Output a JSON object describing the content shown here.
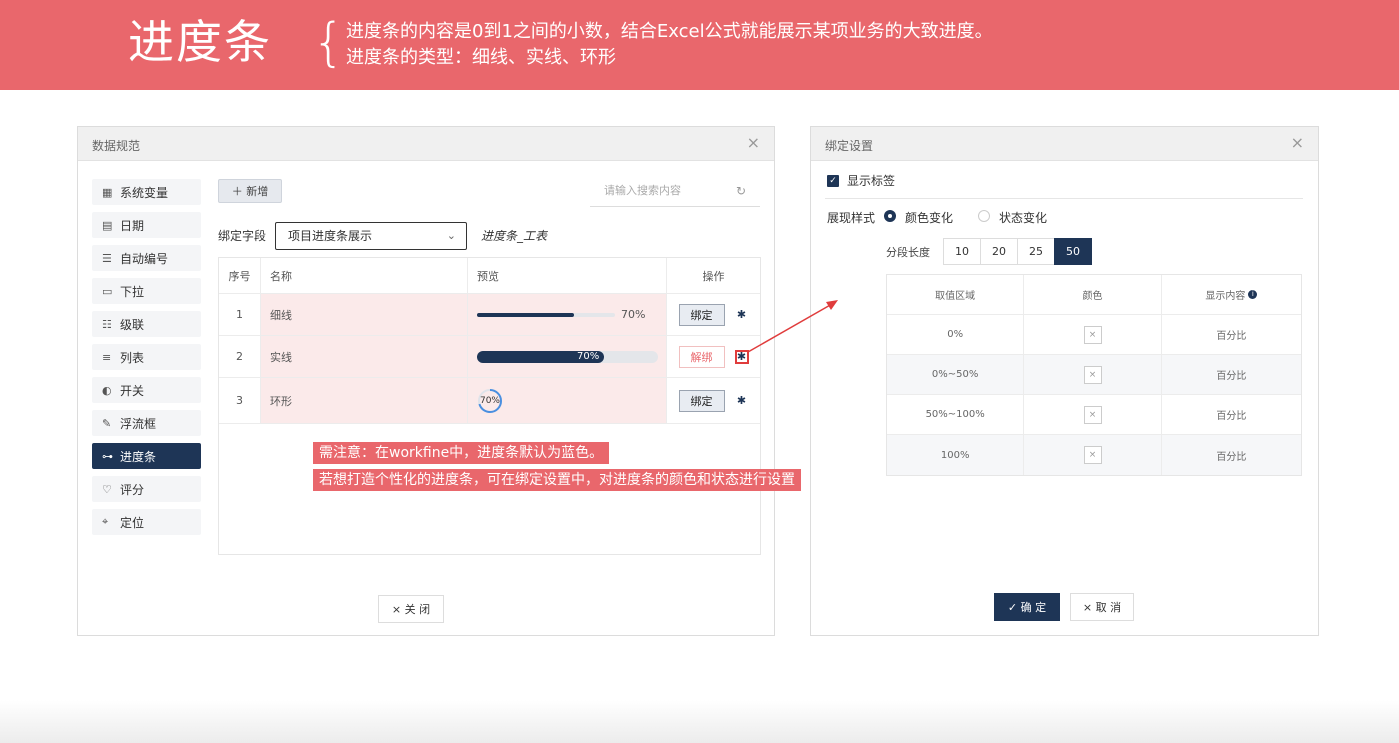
{
  "banner": {
    "title": "进度条",
    "brace": "{",
    "line1": "进度条的内容是0到1之间的小数，结合Excel公式就能展示某项业务的大致进度。",
    "line2": "进度条的类型：细线、实线、环形"
  },
  "left_dialog": {
    "title": "数据规范",
    "close": "×",
    "fields": [
      {
        "icon": "▦",
        "label": "系统变量"
      },
      {
        "icon": "▤",
        "label": "日期"
      },
      {
        "icon": "☰",
        "label": "自动编号"
      },
      {
        "icon": "▭",
        "label": "下拉"
      },
      {
        "icon": "☷",
        "label": "级联"
      },
      {
        "icon": "≡",
        "label": "列表"
      },
      {
        "icon": "◐",
        "label": "开关"
      },
      {
        "icon": "✎",
        "label": "浮流框"
      },
      {
        "icon": "⊶",
        "label": "进度条"
      },
      {
        "icon": "♡",
        "label": "评分"
      },
      {
        "icon": "⌖",
        "label": "定位"
      }
    ],
    "add_label": "＋ 新增",
    "search_placeholder": "请输入搜索内容",
    "refresh_icon": "↻",
    "bind_label": "绑定字段",
    "bind_value": "项目进度条展示",
    "chevron": "⌄",
    "bind_hint": "进度条_工表",
    "table": {
      "headers": [
        "序号",
        "名称",
        "预览",
        "操作"
      ],
      "rows": [
        {
          "idx": "1",
          "name": "细线",
          "pct": "70%",
          "progress": 0.7,
          "op": "绑定"
        },
        {
          "idx": "2",
          "name": "实线",
          "pct": "70%",
          "progress": 0.7,
          "op": "解绑"
        },
        {
          "idx": "3",
          "name": "环形",
          "pct": "70%",
          "progress": 0.7,
          "op": "绑定"
        }
      ]
    },
    "close_btn": "× 关 闭"
  },
  "notes": {
    "n1": "需注意：在workfine中，进度条默认为蓝色。",
    "n2": "若想打造个性化的进度条，可在绑定设置中，对进度条的颜色和状态进行设置"
  },
  "right_dialog": {
    "title": "绑定设置",
    "close": "×",
    "show_label": "显示标签",
    "check": "✓",
    "style_label": "展现样式",
    "radio_on": "颜色变化",
    "radio_off": "状态变化",
    "seg_label": "分段长度",
    "segments": [
      "10",
      "20",
      "25",
      "50"
    ],
    "table_headers": [
      "取值区域",
      "颜色",
      "显示内容"
    ],
    "table_rows": [
      {
        "range": "0%",
        "color": "×",
        "content": "百分比"
      },
      {
        "range": "0%~50%",
        "color": "×",
        "content": "百分比"
      },
      {
        "range": "50%~100%",
        "color": "×",
        "content": "百分比"
      },
      {
        "range": "100%",
        "color": "×",
        "content": "百分比"
      }
    ],
    "ok": "✓ 确 定",
    "cancel": "× 取 消"
  },
  "colors": {
    "accent_red": "#e9676c",
    "navy": "#1e3556"
  }
}
